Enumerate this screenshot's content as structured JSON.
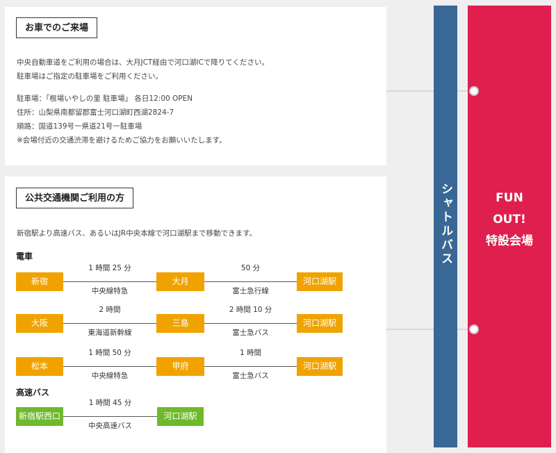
{
  "car": {
    "title": "お車でのご来場",
    "lines": [
      "中央自動車道をご利用の場合は、大月JCT経由で河口湖ICで降りてください。",
      "駐車場はご指定の駐車場をご利用ください。",
      "駐車場：「根場いやしの里 駐車場」 各日12:00 OPEN",
      "住所：山梨県南都留郡富士河口湖町西湖2824-7",
      "順路：国道139号ー県道21号ー駐車場",
      "※会場付近の交通渋滞を避けるためご協力をお願いいたします。"
    ]
  },
  "transit": {
    "title": "公共交通機関ご利用の方",
    "intro": "新宿駅より高速バス、あるいはJR中央本線で河口湖駅まで移動できます。",
    "train_heading": "電車",
    "train_routes": [
      {
        "stations": [
          "新宿",
          "大月",
          "河口湖駅"
        ],
        "times": [
          "1 時間 25 分",
          "50 分"
        ],
        "lines": [
          "中央線特急",
          "富士急行線"
        ]
      },
      {
        "stations": [
          "大阪",
          "三島",
          "河口湖駅"
        ],
        "times": [
          "2 時間",
          "2 時間 10 分"
        ],
        "lines": [
          "東海道新幹線",
          "富士急バス"
        ]
      },
      {
        "stations": [
          "松本",
          "甲府",
          "河口湖駅"
        ],
        "times": [
          "1 時間 50 分",
          "1 時間"
        ],
        "lines": [
          "中央線特急",
          "富士急バス"
        ]
      }
    ],
    "bus_heading": "高速バス",
    "bus_route": {
      "stations": [
        "新宿駅西口",
        "河口湖駅"
      ],
      "time": "1 時間 45 分",
      "line": "中央高速バス"
    }
  },
  "shuttle": {
    "label": "シャトルバス"
  },
  "venue": {
    "lines": [
      "FUN",
      "OUT!",
      "特設会場"
    ]
  },
  "colors": {
    "train_station": "#f0a300",
    "bus_station": "#6fb92c",
    "shuttle": "#3a6896",
    "venue": "#df1f4e"
  }
}
